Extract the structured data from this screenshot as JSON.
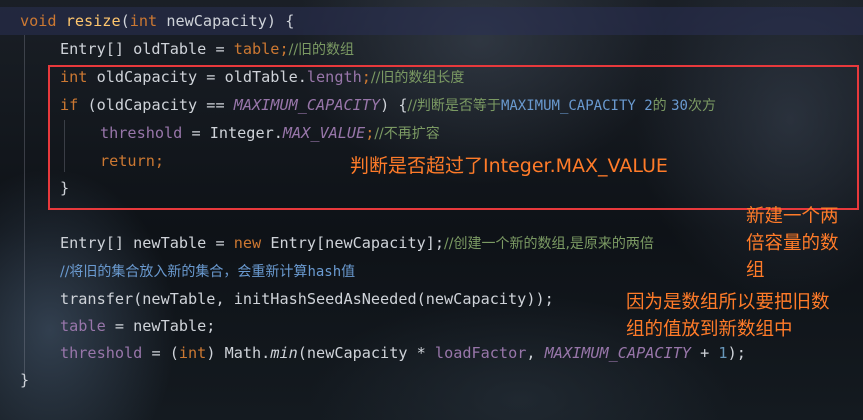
{
  "code_lines": {
    "l1": {
      "kw1": "void",
      "fn": "resize",
      "p1": "(",
      "kw2": "int",
      "p2": " newCapacity) {"
    },
    "l2": {
      "t1": "Entry[] oldTable = ",
      "fd": "table",
      "p": ";",
      "cm": "//旧的数组"
    },
    "l3": {
      "kw": "int",
      "t1": " oldCapacity = oldTable.",
      "fd": "length",
      "p": ";",
      "cm": "//旧的数组长度"
    },
    "l4": {
      "kw": "if",
      "t1": " (oldCapacity == ",
      "st": "MAXIMUM_CAPACITY",
      "t2": ") {",
      "cm1": "//判断是否等于",
      "cm2": "MAXIMUM_CAPACITY 2",
      "cm3": "的 ",
      "cm4": "30",
      "cm5": "次方"
    },
    "l5": {
      "fd": "threshold",
      "t1": " = Integer.",
      "st": "MAX_VALUE",
      "p": ";",
      "cm": "//不再扩容"
    },
    "l6": {
      "kw": "return",
      "p": ";"
    },
    "l7": {
      "t": "}"
    },
    "l8": {
      "t1": "Entry[] newTable = ",
      "kw": "new",
      "t2": " Entry[newCapacity];",
      "cm": "//创建一个新的数组,是原来的两倍"
    },
    "l9": {
      "cm1": "//将旧的集合放入新的集合，会重新计算",
      "cm2": "hash",
      "cm3": "值"
    },
    "l10": {
      "t": "transfer(newTable, initHashSeedAsNeeded(newCapacity));"
    },
    "l11": {
      "fd": "table",
      "t": " = newTable;"
    },
    "l12": {
      "fd1": "threshold",
      "t1": " = (",
      "kw": "int",
      "t2": ") Math.",
      "it": "min",
      "t3": "(newCapacity * ",
      "fd2": "loadFactor",
      "t4": ", ",
      "st": "MAXIMUM_CAPACITY",
      "t5": " + ",
      "num": "1",
      "t6": ");"
    },
    "l13": {
      "t": "}"
    }
  },
  "annotations": {
    "box_note": "判断是否超过了Integer.MAX_VALUE",
    "note2_l1": "新建一个两",
    "note2_l2": "倍容量的数",
    "note2_l3": "组",
    "note3_l1": "因为是数组所以要把旧数",
    "note3_l2": "组的值放到新数组中"
  },
  "colors": {
    "keyword": "#cc7832",
    "method": "#ffc66d",
    "field": "#9876aa",
    "comment": "#7b9a63",
    "annotation": "#ff7b29",
    "highlight_box": "#e8393c"
  }
}
